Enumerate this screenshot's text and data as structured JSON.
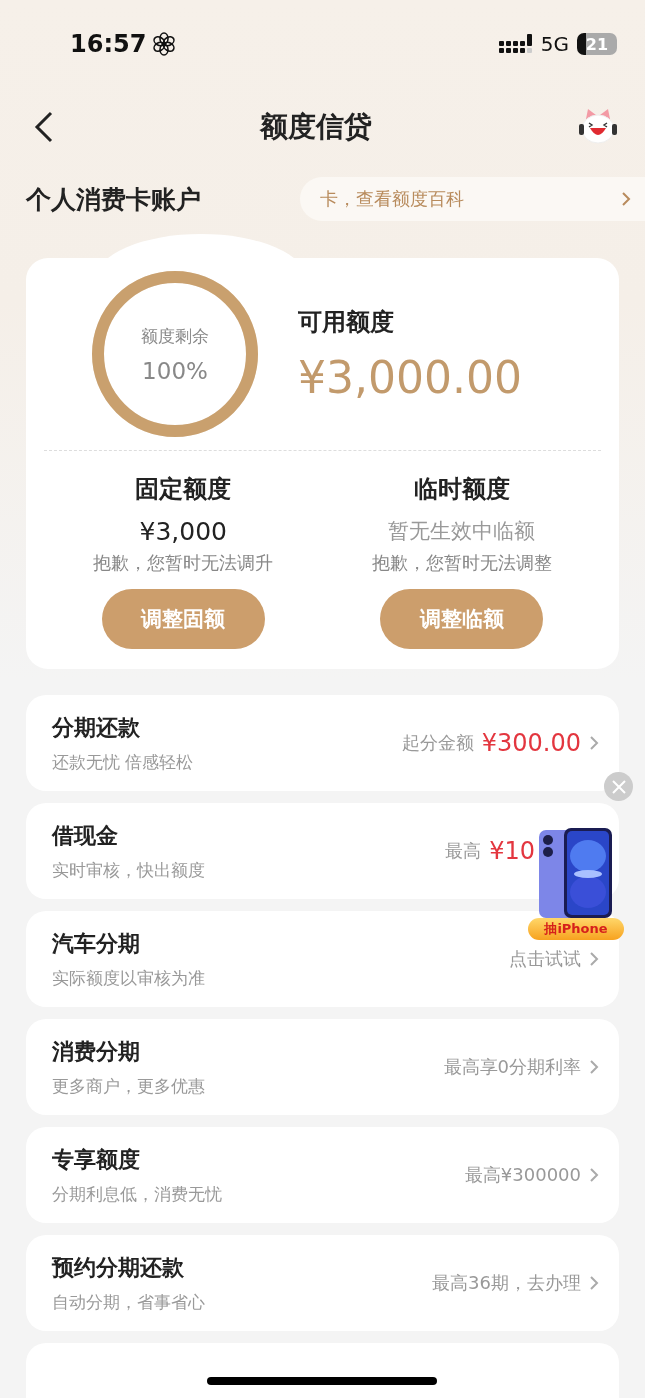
{
  "status_bar": {
    "time": "16:57",
    "network": "5G",
    "battery": "21"
  },
  "nav": {
    "title": "额度信贷"
  },
  "section": {
    "title": "个人消费卡账户",
    "tip": "卡，查看额度百科"
  },
  "credit": {
    "ring_label": "额度剩余",
    "ring_value": "100%",
    "level": 1,
    "available_label": "可用额度",
    "available_amount": "¥3,000.00",
    "columns": [
      {
        "title": "固定额度",
        "value": "¥3,000",
        "muted": false,
        "note": "抱歉，您暂时无法调升",
        "button": "调整固额"
      },
      {
        "title": "临时额度",
        "value": "暂无生效中临额",
        "muted": true,
        "note": "抱歉，您暂时无法调整",
        "button": "调整临额"
      }
    ]
  },
  "services": [
    {
      "title": "分期还款",
      "subtitle": "还款无忧 倍感轻松",
      "hint": "起分金额",
      "amount": "¥300.00",
      "chevron": true
    },
    {
      "title": "借现金",
      "subtitle": "实时审核，快出额度",
      "hint": "最高",
      "amount": "¥10",
      "chevron": false
    },
    {
      "title": "汽车分期",
      "subtitle": "实际额度以审核为准",
      "hint": "点击试试",
      "chevron": true
    },
    {
      "title": "消费分期",
      "subtitle": "更多商户，更多优惠",
      "hint": "最高享0分期利率",
      "chevron": true
    },
    {
      "title": "专享额度",
      "subtitle": "分期利息低，消费无忧",
      "hint": "最高¥300000",
      "chevron": true
    },
    {
      "title": "预约分期还款",
      "subtitle": "自动分期，省事省心",
      "hint": "最高36期，去办理",
      "chevron": true
    },
    {
      "chevron": false
    }
  ],
  "promo": {
    "badge": "抽iPhone"
  }
}
